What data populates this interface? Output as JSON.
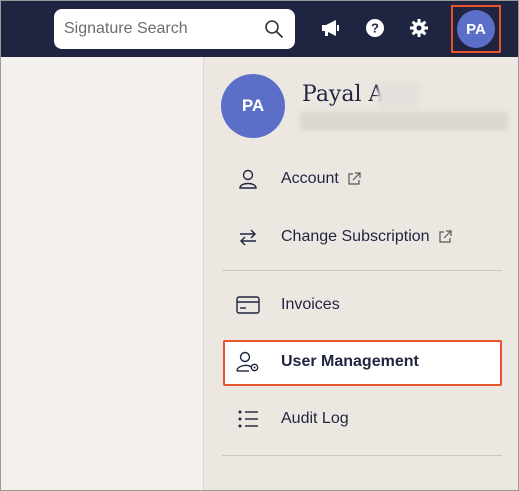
{
  "search": {
    "placeholder": "Signature Search"
  },
  "topbar": {
    "icons": [
      "megaphone-icon",
      "help-icon",
      "settings-icon"
    ],
    "avatar_initials": "PA"
  },
  "profile": {
    "initials": "PA",
    "name": "Payal A"
  },
  "menu": {
    "items": [
      {
        "label": "Account",
        "icon": "user-icon",
        "external": true
      },
      {
        "label": "Change Subscription",
        "icon": "swap-arrows-icon",
        "external": true
      },
      {
        "label": "Invoices",
        "icon": "credit-card-icon",
        "external": false
      },
      {
        "label": "User Management",
        "icon": "user-settings-icon",
        "external": false,
        "active": true
      },
      {
        "label": "Audit Log",
        "icon": "list-icon",
        "external": false
      }
    ]
  },
  "colors": {
    "topbar": "#1f2540",
    "avatar": "#5c6fc8",
    "highlight": "#e8552c",
    "menu_bg": "#ede7e1"
  }
}
